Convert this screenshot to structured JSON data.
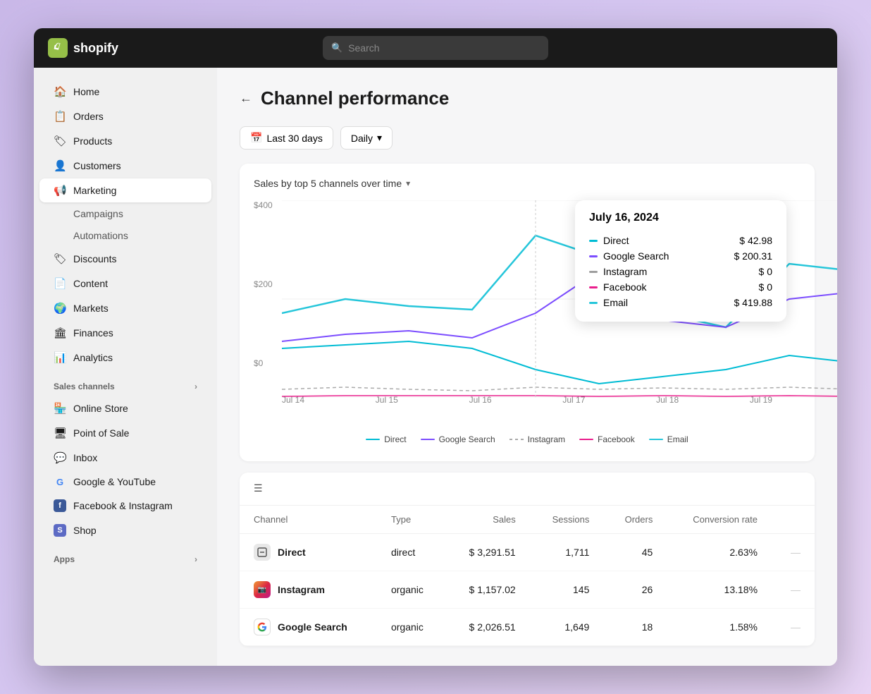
{
  "app": {
    "logo_text": "shopify",
    "logo_icon": "🛍"
  },
  "topbar": {
    "search_placeholder": "Search"
  },
  "sidebar": {
    "nav_items": [
      {
        "id": "home",
        "label": "Home",
        "icon": "🏠"
      },
      {
        "id": "orders",
        "label": "Orders",
        "icon": "🧾"
      },
      {
        "id": "products",
        "label": "Products",
        "icon": "🏷"
      },
      {
        "id": "customers",
        "label": "Customers",
        "icon": "👤"
      },
      {
        "id": "marketing",
        "label": "Marketing",
        "icon": "📢",
        "active": true
      }
    ],
    "marketing_sub": [
      {
        "id": "campaigns",
        "label": "Campaigns"
      },
      {
        "id": "automations",
        "label": "Automations"
      }
    ],
    "nav_items2": [
      {
        "id": "discounts",
        "label": "Discounts",
        "icon": "🏷"
      },
      {
        "id": "content",
        "label": "Content",
        "icon": "📄"
      },
      {
        "id": "markets",
        "label": "Markets",
        "icon": "🌍"
      },
      {
        "id": "finances",
        "label": "Finances",
        "icon": "🏛"
      },
      {
        "id": "analytics",
        "label": "Analytics",
        "icon": "📊"
      }
    ],
    "sales_channels_label": "Sales channels",
    "sales_channels": [
      {
        "id": "online-store",
        "label": "Online Store",
        "icon": "🏪"
      },
      {
        "id": "point-of-sale",
        "label": "Point of Sale",
        "icon": "🖥"
      },
      {
        "id": "inbox",
        "label": "Inbox",
        "icon": "💬"
      },
      {
        "id": "google-youtube",
        "label": "Google & YouTube",
        "icon": "G"
      },
      {
        "id": "facebook-instagram",
        "label": "Facebook & Instagram",
        "icon": "f"
      },
      {
        "id": "shop",
        "label": "Shop",
        "icon": "S"
      }
    ],
    "apps_label": "Apps"
  },
  "page": {
    "title": "Channel performance",
    "back_label": "←"
  },
  "filters": {
    "date_range": "Last 30 days",
    "interval": "Daily",
    "date_icon": "📅"
  },
  "chart": {
    "title": "Sales by top 5 channels over time",
    "y_labels": [
      "$400",
      "$200",
      "$0"
    ],
    "x_labels": [
      "Jul 14",
      "Jul 15",
      "Jul 16",
      "Jul 17",
      "Jul 18",
      "Jul 19"
    ],
    "tooltip": {
      "date": "July 16, 2024",
      "rows": [
        {
          "channel": "Direct",
          "value": "$ 42.98",
          "color": "#00bcd4"
        },
        {
          "channel": "Google Search",
          "value": "$ 200.31",
          "color": "#7c4dff"
        },
        {
          "channel": "Instagram",
          "value": "$ 0",
          "color": "#9e9e9e"
        },
        {
          "channel": "Facebook",
          "value": "$ 0",
          "color": "#e91e8c"
        },
        {
          "channel": "Email",
          "value": "$ 419.88",
          "color": "#26c6da"
        }
      ]
    },
    "legend": [
      {
        "label": "Direct",
        "color": "#00bcd4"
      },
      {
        "label": "Google Search",
        "color": "#7c4dff"
      },
      {
        "label": "Instagram",
        "color": "#aaaaaa"
      },
      {
        "label": "Facebook",
        "color": "#e91e8c"
      },
      {
        "label": "Email",
        "color": "#26c6da"
      }
    ]
  },
  "table": {
    "columns": [
      "Channel",
      "Type",
      "Sales",
      "Sessions",
      "Orders",
      "Conversion rate"
    ],
    "rows": [
      {
        "channel": "Direct",
        "icon": "🔲",
        "icon_bg": "#e8e8e8",
        "type": "direct",
        "sales": "$ 3,291.51",
        "sessions": "1,711",
        "orders": "45",
        "conversion": "2.63%",
        "channel_id": "direct"
      },
      {
        "channel": "Instagram",
        "icon": "📸",
        "icon_bg": "#f4d0ff",
        "type": "organic",
        "sales": "$ 1,157.02",
        "sessions": "145",
        "orders": "26",
        "conversion": "13.18%",
        "channel_id": "instagram"
      },
      {
        "channel": "Google Search",
        "icon": "G",
        "icon_bg": "#fff",
        "type": "organic",
        "sales": "$ 2,026.51",
        "sessions": "1,649",
        "orders": "18",
        "conversion": "1.58%",
        "channel_id": "google"
      }
    ]
  }
}
